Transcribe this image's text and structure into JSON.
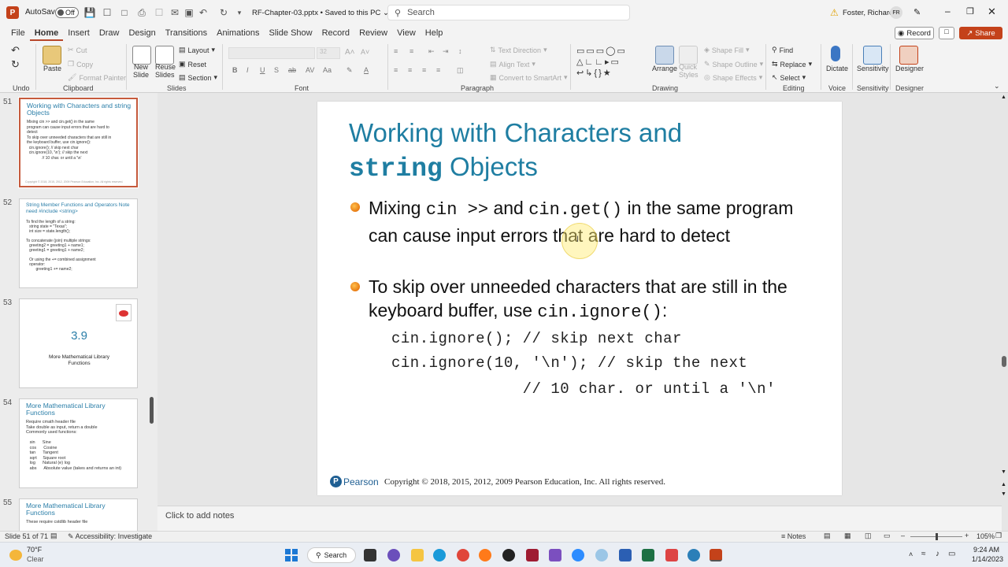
{
  "app": {
    "autosave_label": "AutoSave",
    "autosave_state": "Off",
    "doc_title": "RF-Chapter-03.pptx",
    "save_status": "Saved to this PC",
    "search_placeholder": "Search",
    "user_name": "Foster, Richard",
    "user_initials": "FR"
  },
  "menu": {
    "items": [
      "File",
      "Home",
      "Insert",
      "Draw",
      "Design",
      "Transitions",
      "Animations",
      "Slide Show",
      "Record",
      "Review",
      "View",
      "Help"
    ],
    "record_button": "Record",
    "share_button": "Share"
  },
  "ribbon": {
    "undo_group": "Undo",
    "clipboard": {
      "paste": "Paste",
      "cut": "Cut",
      "copy": "Copy",
      "format_painter": "Format Painter",
      "label": "Clipboard"
    },
    "slides": {
      "new_slide": "New Slide",
      "reuse_slides": "Reuse Slides",
      "layout": "Layout",
      "reset": "Reset",
      "section": "Section",
      "label": "Slides"
    },
    "font": {
      "size": "32",
      "label": "Font"
    },
    "paragraph": {
      "text_direction": "Text Direction",
      "align_text": "Align Text",
      "convert_smartart": "Convert to SmartArt",
      "label": "Paragraph"
    },
    "drawing": {
      "arrange": "Arrange",
      "quick_styles": "Quick Styles",
      "shape_fill": "Shape Fill",
      "shape_outline": "Shape Outline",
      "shape_effects": "Shape Effects",
      "label": "Drawing"
    },
    "editing": {
      "find": "Find",
      "replace": "Replace",
      "select": "Select",
      "label": "Editing"
    },
    "voice": {
      "dictate": "Dictate",
      "label": "Voice"
    },
    "sensitivity": {
      "button": "Sensitivity",
      "label": "Sensitivity"
    },
    "designer": {
      "button": "Designer",
      "label": "Designer"
    }
  },
  "thumbnails": [
    {
      "num": "51",
      "title": "Working with Characters and string Objects",
      "text": "Mixing cin >> and cin.get() in the same\nprogram can cause input errors that are hard to\ndetect\nTo skip over unneeded characters that are still in\nthe keyboard buffer, use cin.ignore():\n  cin.ignore(); // skip next char\n  cin.ignore(10, '\\n'); // skip the next\n              // 10 char. or until a '\\n'"
    },
    {
      "num": "52",
      "title": "String Member Functions and Operators Note need #include <string>",
      "text": "To find the length of a string:\n   string state = \"Texas\";\n   int size = state.length();\n\nTo concatenate (join) multiple strings:\n   greeting2 = greeting1 + name1;\n   greeting1 = greeting1 + name2;\n\n   Or using the += combined assignment\n   operator:\n         greeting1 += name2;"
    },
    {
      "num": "53",
      "title": "3.9",
      "text": "More Mathematical Library\nFunctions"
    },
    {
      "num": "54",
      "title": "More Mathematical Library Functions",
      "text": "Require cmath header file\nTake double as input, return a double\nCommonly used functions:\n\n   sin      Sine\n   cos      Cosine\n   tan      Tangent\n   sqrt     Square root\n   log      Natural (e) log\n   abs      Absolute value (takes and returns an int)"
    },
    {
      "num": "55",
      "title": "More Mathematical Library Functions",
      "text": "These require cstdlib header file"
    }
  ],
  "slide": {
    "title_line1": "Working with Characters and",
    "title_code": "string",
    "title_line2_rest": " Objects",
    "bullet1": {
      "a": "Mixing ",
      "code1": "cin >>",
      "b": " and ",
      "code2": "cin.get()",
      "c": " in the same program can cause input errors that are hard to detect"
    },
    "bullet2": {
      "a": "To skip over unneeded characters that are still in the keyboard buffer, use ",
      "code": "cin.ignore()",
      "b": ":"
    },
    "code_lines": [
      "cin.ignore(); // skip next char",
      "cin.ignore(10, '\\n'); // skip the next",
      "              // 10 char. or until a '\\n'"
    ],
    "logo_text": "Pearson",
    "copyright": "Copyright © 2018, 2015, 2012, 2009 Pearson Education, Inc. All rights reserved."
  },
  "notes_placeholder": "Click to add notes",
  "status": {
    "slide_info": "Slide 51 of 71",
    "accessibility": "Accessibility: Investigate",
    "notes": "Notes",
    "zoom": "105%"
  },
  "taskbar": {
    "weather_temp": "70°F",
    "weather_desc": "Clear",
    "search": "Search",
    "time": "9:24 AM",
    "date": "1/14/2023"
  },
  "colors": {
    "accent": "#b7472a",
    "title_blue": "#1f7ea2",
    "share": "#c4421a"
  }
}
